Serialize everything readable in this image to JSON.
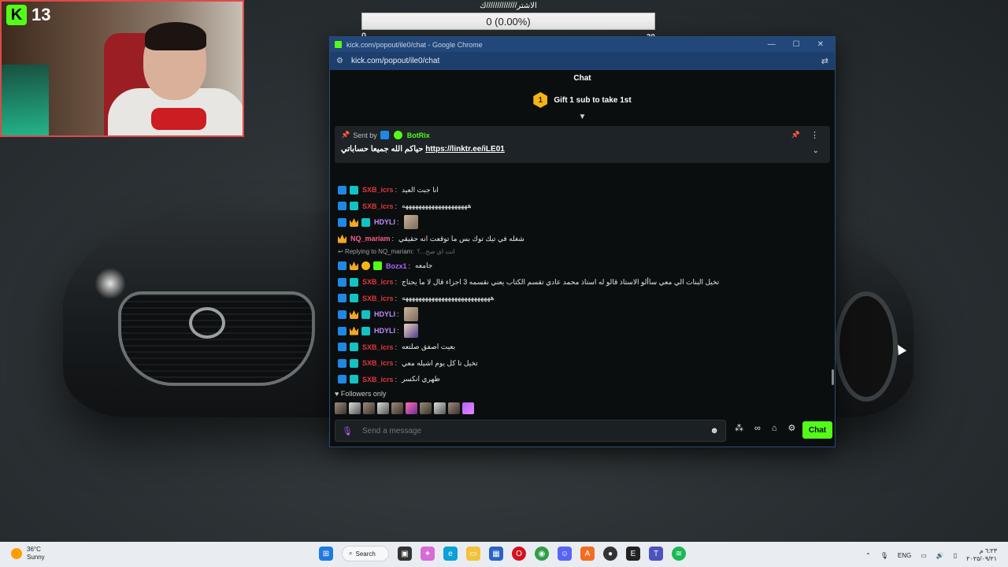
{
  "webcam": {
    "kick_count": "13"
  },
  "goal": {
    "title": "الاشتر//////////////ك",
    "progress_text": "0 (0.00%)",
    "min": "0",
    "max": "30",
    "progress_fraction": 0
  },
  "window": {
    "title": "kick.com/popout/ile0/chat - Google Chrome",
    "url": "kick.com/popout/ile0/chat"
  },
  "chat": {
    "header": "Chat",
    "gift": {
      "coin_label": "1",
      "text": "Gift 1 sub to take 1st"
    },
    "pinned": {
      "sent_by_label": "Sent by",
      "bot_name": "BotRix",
      "message_text": "حياكم الله جميعا حساباتي",
      "link": "https://linktr.ee/iLE01"
    },
    "messages": [
      {
        "user": "SXB_icrs",
        "color": "red",
        "badges": [
          "mod",
          "tier"
        ],
        "text": "انا جبت العيد"
      },
      {
        "user": "SXB_icrs",
        "color": "red",
        "badges": [
          "mod",
          "tier"
        ],
        "text": "ههههههههههههههههههههه"
      },
      {
        "user": "HDYLI",
        "color": "purple",
        "badges": [
          "mod",
          "crown",
          "tier"
        ],
        "emote": true
      },
      {
        "user": "NQ_mariam",
        "color": "pink",
        "badges": [
          "crown"
        ],
        "text": "شغله في تيك توك بس ما توقعت انه حقيقي"
      },
      {
        "reply_to": "Replying to NQ_mariam:",
        "reply_text": "انت اي صح...؟"
      },
      {
        "user": "Bozx1",
        "color": "violet",
        "badges": [
          "mod",
          "crown",
          "coin",
          "gift"
        ],
        "text": "جامعه"
      },
      {
        "user": "SXB_icrs",
        "color": "red",
        "badges": [
          "mod",
          "tier"
        ],
        "text": "تخيل البنات الي معي ساألو الاستاذ قالو له استاذ محمد عادي تقسم الكتاب يعني نقسمه 3 اجزاء قال لا ما يحتاج"
      },
      {
        "user": "SXB_icrs",
        "color": "red",
        "badges": [
          "mod",
          "tier"
        ],
        "text": "هههههههههههههههههههههههههههه"
      },
      {
        "user": "HDYLI",
        "color": "purple",
        "badges": [
          "mod",
          "crown",
          "tier"
        ],
        "emote": true
      },
      {
        "user": "HDYLI",
        "color": "purple",
        "badges": [
          "mod",
          "crown",
          "tier"
        ],
        "emote": true
      },
      {
        "user": "SXB_icrs",
        "color": "red",
        "badges": [
          "mod",
          "tier"
        ],
        "text": "بعيت اصفق صلتعه"
      },
      {
        "user": "SXB_icrs",
        "color": "red",
        "badges": [
          "mod",
          "tier"
        ],
        "text": "تخيل تا كل يوم اشيله معي"
      },
      {
        "user": "SXB_icrs",
        "color": "red",
        "badges": [
          "mod",
          "tier"
        ],
        "text": "ظهري انكسر"
      }
    ],
    "followers_only": "Followers only",
    "composer_placeholder": "Send a message",
    "send_label": "Chat"
  },
  "taskbar": {
    "temperature": "36°C",
    "weather": "Sunny",
    "search_label": "Search",
    "language": "ENG",
    "time": "٦:٢٣ م",
    "date": "٢٠٢٥/٠٩/٢١"
  }
}
